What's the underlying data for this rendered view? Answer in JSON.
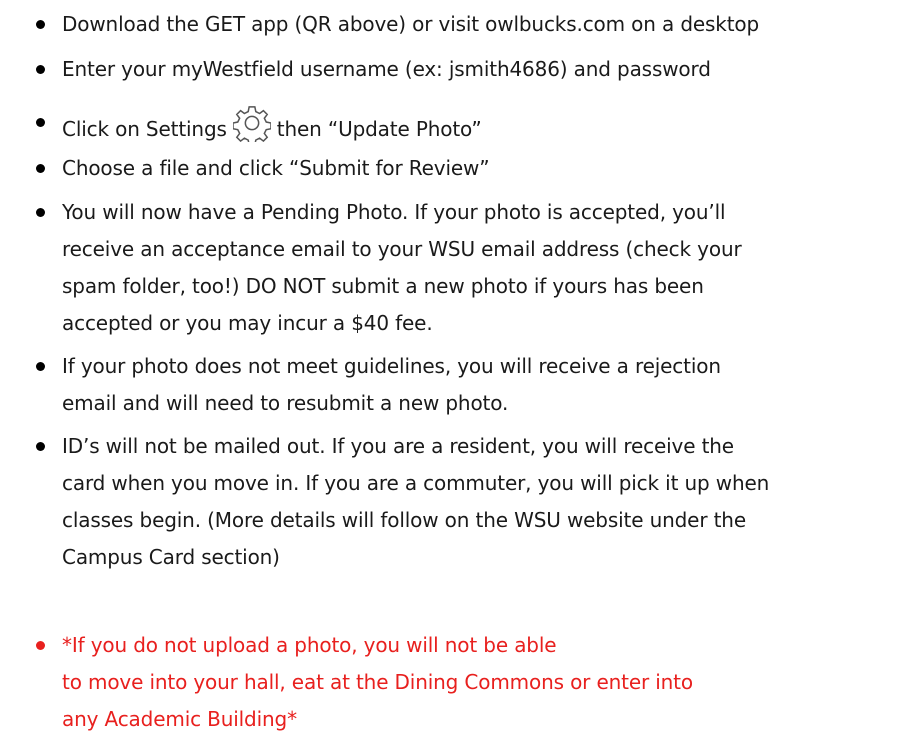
{
  "instructions": {
    "items": [
      {
        "lines": [
          "Download the GET app (QR above) or visit owlbucks.com on a desktop"
        ]
      },
      {
        "lines": [
          "Enter your myWestfield username (ex: jsmith4686) and password"
        ]
      },
      {
        "before_icon": "Click on Settings",
        "icon": "gear-icon",
        "after_icon": "then “Update Photo”"
      },
      {
        "lines": [
          "Choose a file and click “Submit for Review”"
        ]
      },
      {
        "lines": [
          "You will now have a Pending Photo.  If your photo is accepted, you’ll",
          "receive an acceptance email to your WSU email address (check your",
          "spam folder, too!)   DO NOT submit a new photo if yours has been",
          "accepted or you may incur a $40 fee."
        ]
      },
      {
        "lines": [
          "If your photo does not meet guidelines, you will receive a rejection",
          "email and will need to resubmit a new photo."
        ]
      },
      {
        "lines": [
          "ID’s will not be mailed out. If you are a resident, you will receive the",
          "card when you move in. If you are a commuter, you will pick it up when",
          "classes begin. (More details will follow on the WSU website under the",
          "Campus Card section)"
        ]
      },
      {
        "lines": [
          "*If you do not upload a photo, you will not be able",
          "to move into your hall, eat at the Dining Commons or enter into",
          "any Academic Building*"
        ]
      }
    ],
    "colors": {
      "text": "#1a1a1a",
      "warning": "#e8201e",
      "bullet": "#000000"
    }
  }
}
